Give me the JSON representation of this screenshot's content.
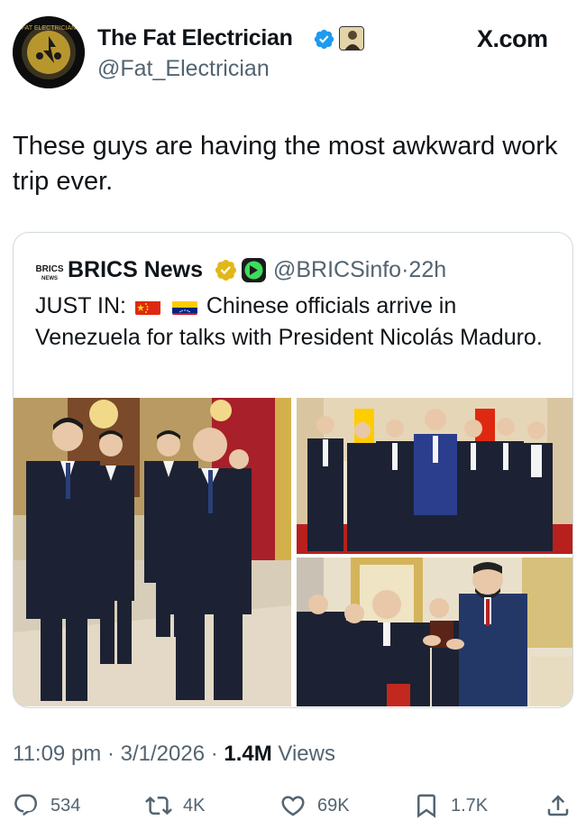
{
  "author": {
    "name": "The Fat Electrician",
    "handle": "@Fat_Electrician",
    "avatar_text": "FAT ELECTRICIAN"
  },
  "site": "X.com",
  "tweet": {
    "text": "These guys are having the most awkward work trip ever."
  },
  "quote": {
    "logo_text": "BRICS NEWS",
    "name": "BRICS News",
    "handle": "@BRICSinfo",
    "separator": "·",
    "time": "22h",
    "text_prefix": "JUST IN:",
    "text_body": "Chinese officials arrive in Venezuela for talks with President Nicolás Maduro.",
    "flags": [
      "china-flag",
      "venezuela-flag"
    ],
    "images": [
      "officials-walking-photo",
      "group-photo",
      "gift-exchange-photo"
    ]
  },
  "meta": {
    "time": "11:09 pm",
    "sep1": " · ",
    "date": "3/1/2026",
    "sep2": " · ",
    "views_count": "1.4M",
    "views_label": " Views"
  },
  "actions": {
    "replies": "534",
    "reposts": "4K",
    "likes": "69K",
    "bookmarks": "1.7K"
  },
  "colors": {
    "text": "#0f1419",
    "secondary": "#536471",
    "border": "#cfd9de",
    "verified_blue": "#1d9bf0",
    "verified_gold": "#e2b719"
  }
}
